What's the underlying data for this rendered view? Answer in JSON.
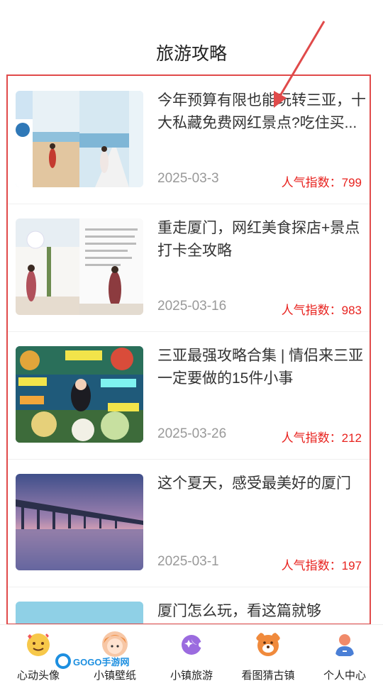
{
  "header": {
    "title": "旅游攻略"
  },
  "articles": [
    {
      "title": "今年预算有限也能玩转三亚，十大私藏免费网红景点?吃住买...",
      "date": "2025-03-3",
      "popularity": "人气指数：799"
    },
    {
      "title": "重走厦门，网红美食探店+景点打卡全攻略",
      "date": "2025-03-16",
      "popularity": "人气指数：983"
    },
    {
      "title": "三亚最强攻略合集 | 情侣来三亚一定要做的15件小事",
      "date": "2025-03-26",
      "popularity": "人气指数：212"
    },
    {
      "title": "这个夏天，感受最美好的厦门",
      "date": "2025-03-1",
      "popularity": "人气指数：197"
    },
    {
      "title": "厦门怎么玩，看这篇就够",
      "date": "",
      "popularity": ""
    }
  ],
  "tabs": [
    {
      "label": "心动头像",
      "icon": "emoji-face-icon",
      "color": "#f7c34a"
    },
    {
      "label": "小镇壁纸",
      "icon": "girl-avatar-icon",
      "color": "#f5a46a"
    },
    {
      "label": "小镇旅游",
      "icon": "planet-icon",
      "color": "#9b6bdf"
    },
    {
      "label": "看图猜古镇",
      "icon": "bear-face-icon",
      "color": "#f08a3c"
    },
    {
      "label": "个人中心",
      "icon": "person-icon",
      "color": "#4a7fd6"
    }
  ],
  "watermark": {
    "text": "GOGO手游网"
  },
  "colors": {
    "accent": "#e8231f",
    "annotation": "#e04a4a"
  }
}
